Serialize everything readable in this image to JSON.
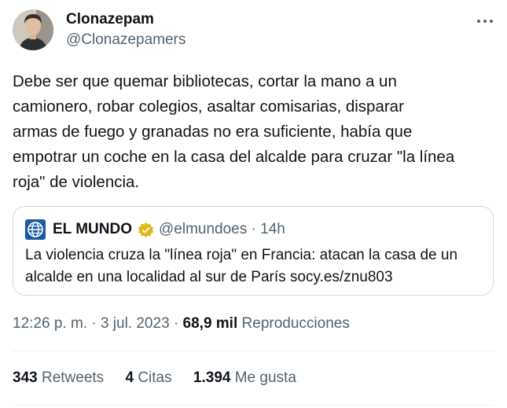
{
  "author": {
    "display_name": "Clonazepam",
    "handle": "@Clonazepamers",
    "avatar": "man-portrait-avatar"
  },
  "tweet": {
    "text": "Debe ser que quemar bibliotecas, cortar la mano a un\ncamionero, robar colegios, asaltar comisarias, disparar\narmas de fuego y granadas no era suficiente, había que\nempotrar un coche en la casa del alcalde para cruzar \"la línea\nroja\" de violencia."
  },
  "quote": {
    "name": "EL MUNDO",
    "handle": "@elmundoes",
    "separator": "·",
    "age": "14h",
    "text": "La violencia cruza la \"línea roja\" en Francia: atacan la casa de un\nalcalde en una localidad al sur de París socy.es/znu803",
    "logo": "el-mundo-globe-logo",
    "verified_icon": "gold-verified-badge",
    "colors": {
      "logo_blue": "#1b5aa6",
      "verified_gold": "#e2b719"
    }
  },
  "meta": {
    "time": "12:26 p. m.",
    "separator": "·",
    "date": "3 jul. 2023",
    "views_count": "68,9 mil",
    "views_label": "Reproducciones"
  },
  "stats": {
    "retweets_count": "343",
    "retweets_label": "Retweets",
    "quotes_count": "4",
    "quotes_label": "Citas",
    "likes_count": "1.394",
    "likes_label": "Me gusta"
  },
  "colors": {
    "text_primary": "#0f1419",
    "text_secondary": "#536471",
    "border": "#cfd9de",
    "divider": "#eff3f4"
  }
}
